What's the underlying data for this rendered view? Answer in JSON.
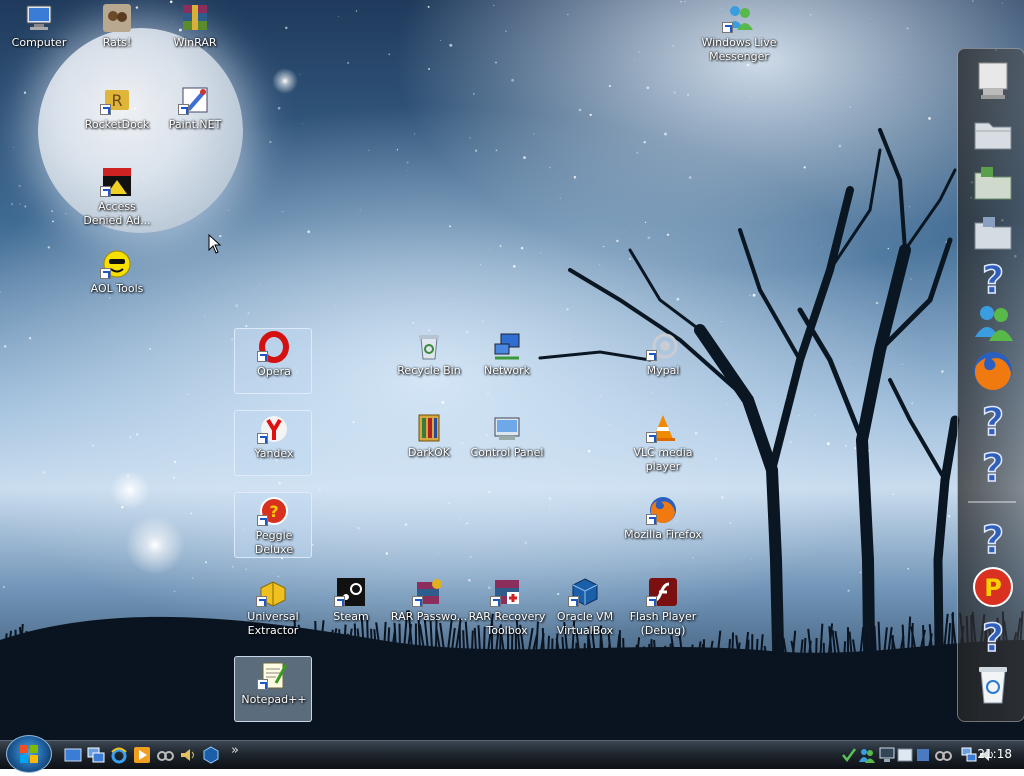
{
  "desktop_icons": {
    "computer": "Computer",
    "rats": "Rats!",
    "winrar": "WinRAR",
    "windows_live_messenger": "Windows Live Messenger",
    "rocketdock": "RocketDock",
    "paint_net": "Paint.NET",
    "access_denied": "Access Denied Ad...",
    "aol_tools": "AOL Tools",
    "opera": "Opera",
    "recycle_bin": "Recycle Bin",
    "network": "Network",
    "mypal": "Mypal",
    "yandex": "Yandex",
    "darkok": "DarkOK",
    "control_panel": "Control Panel",
    "vlc": "VLC media player",
    "peggle": "Peggle Deluxe",
    "firefox": "Mozilla Firefox",
    "universal_extractor": "Universal Extractor",
    "steam": "Steam",
    "rar_password": "RAR Passwo...",
    "rar_recovery": "RAR Recovery Toolbox",
    "virtualbox": "Oracle VM VirtualBox",
    "flash_player": "Flash Player (Debug)",
    "notepadpp": "Notepad++"
  },
  "dock": {
    "items": [
      "computer-icon",
      "folder-icon",
      "folder-icon",
      "folder-icon",
      "help-icon",
      "messenger-icon",
      "firefox-icon",
      "help-icon",
      "help-icon",
      "help-icon",
      "peggle-icon",
      "help-icon",
      "recycle-bin-icon"
    ]
  },
  "taskbar": {
    "quick_launch": [
      "show-desktop-icon",
      "switch-windows-icon",
      "internet-explorer-icon",
      "media-player-icon",
      "speedfan-icon",
      "volume-icon",
      "virtualbox-icon"
    ],
    "overflow": "»",
    "clock": "21:18"
  },
  "colors": {
    "accent": "#1d5c99",
    "taskbar": "#1f262e"
  }
}
